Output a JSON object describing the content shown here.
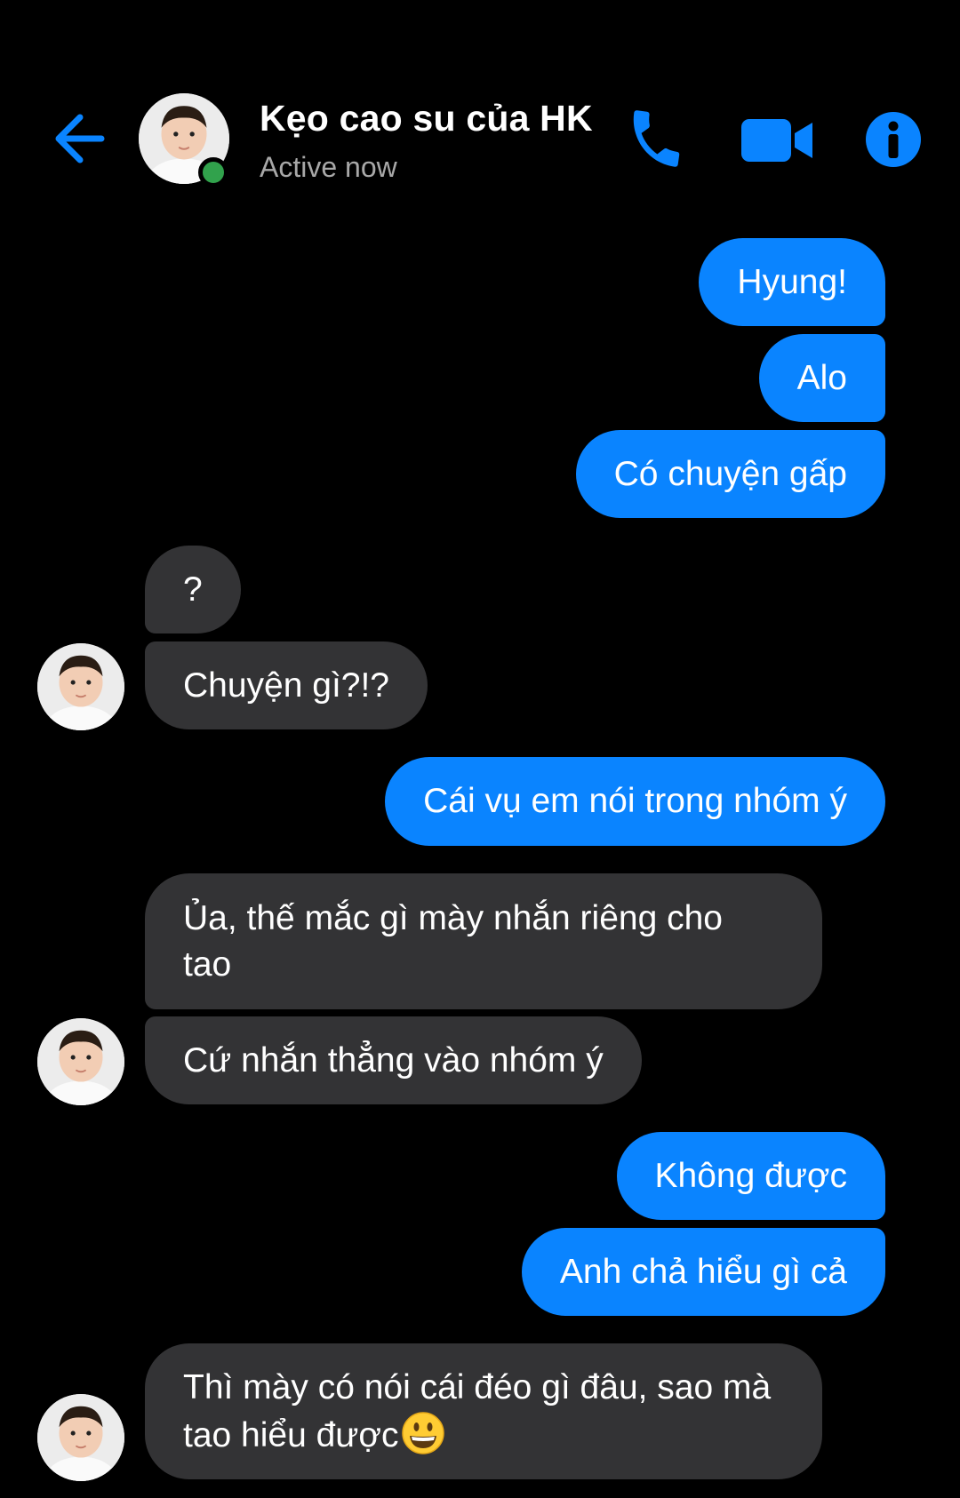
{
  "header": {
    "contact_name": "Kẹo cao su của HK",
    "status": "Active now"
  },
  "messages": [
    {
      "direction": "out",
      "text": "Hyung!"
    },
    {
      "direction": "out",
      "text": "Alo"
    },
    {
      "direction": "out",
      "text": "Có chuyện gấp"
    },
    {
      "direction": "in",
      "text": "?"
    },
    {
      "direction": "in",
      "text": "Chuyện gì?!?"
    },
    {
      "direction": "out",
      "text": "Cái vụ em nói trong nhóm ý"
    },
    {
      "direction": "in",
      "text": "Ủa, thế mắc gì mày nhắn riêng cho tao"
    },
    {
      "direction": "in",
      "text": "Cứ nhắn thẳng vào nhóm ý"
    },
    {
      "direction": "out",
      "text": "Không được"
    },
    {
      "direction": "out",
      "text": "Anh chả hiểu gì cả"
    },
    {
      "direction": "in",
      "text": "Thì mày có nói cái đéo gì đâu, sao mà tao hiểu được",
      "emoji": "grinning-face-emoji"
    }
  ],
  "icons": {
    "back": "back-arrow-icon",
    "call": "phone-icon",
    "video": "video-camera-icon",
    "info": "info-icon"
  },
  "colors": {
    "background": "#000000",
    "accent": "#0a84ff",
    "outgoing_bubble": "#0a84ff",
    "incoming_bubble": "#333335",
    "online": "#31a24c",
    "status_text": "#a8a8a8"
  }
}
